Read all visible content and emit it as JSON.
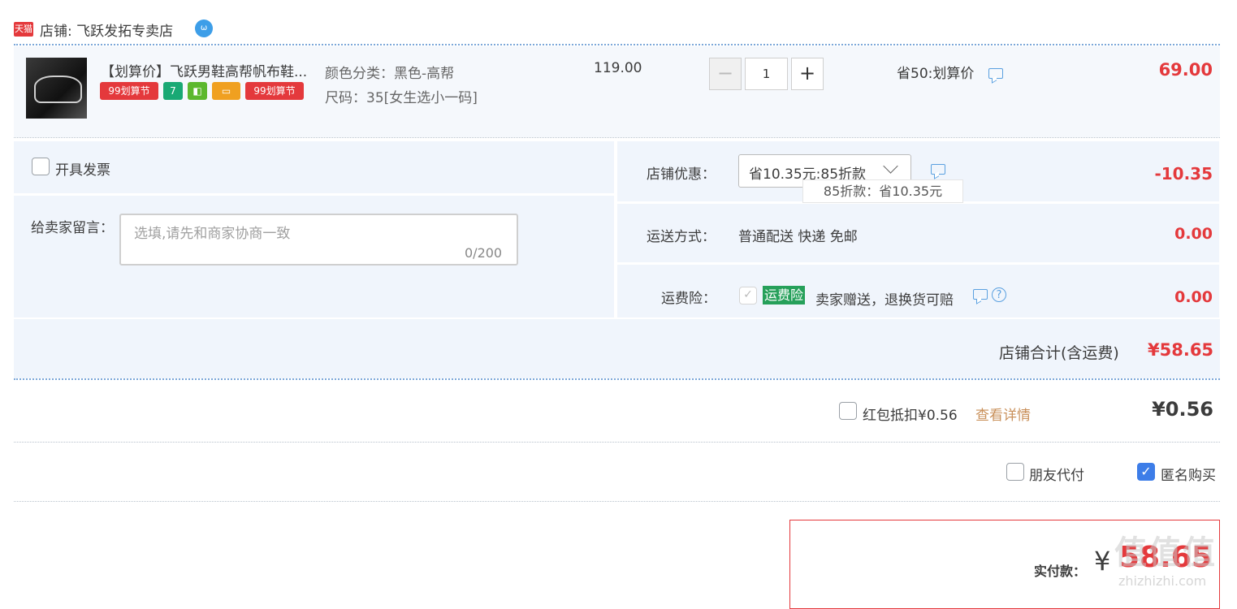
{
  "shop": {
    "logo_text": "天猫",
    "name": "店铺: 飞跃发拓专卖店",
    "im_icon": "wangwang-icon"
  },
  "product": {
    "title": "【划算价】飞跃男鞋高帮帆布鞋...",
    "badges": [
      {
        "text": "99划算节",
        "color": "#e4393c"
      },
      {
        "text": "7",
        "color": "#19a974"
      },
      {
        "text": "◧",
        "color": "#5cb82e"
      },
      {
        "text": "▭",
        "color": "#f0a020"
      },
      {
        "text": "99划算节",
        "color": "#e4393c"
      }
    ],
    "color_attr": "颜色分类：黑色-高帮",
    "size_attr": "尺码：35[女生选小一码]",
    "unit_price": "119.00",
    "quantity": "1",
    "minus_label": "−",
    "plus_label": "+",
    "promo": "省50:划算价",
    "total": "69.00"
  },
  "invoice": {
    "label": "开具发票",
    "checked": false
  },
  "message": {
    "label": "给卖家留言：",
    "placeholder": "选填,请先和商家协商一致",
    "counter": "0/200"
  },
  "shop_discount": {
    "label": "店铺优惠：",
    "selected": "省10.35元:85折款",
    "tooltip": "85折款：省10.35元",
    "amount": "-10.35"
  },
  "shipping": {
    "label": "运送方式：",
    "value": "普通配送 快递 免邮",
    "amount": "0.00"
  },
  "insurance": {
    "label": "运费险：",
    "tag": "运费险",
    "desc": "卖家赠送，退换货可赔",
    "help": "?",
    "amount": "0.00"
  },
  "shop_total": {
    "label": "店铺合计(含运费)",
    "value": "¥58.65"
  },
  "red_packet": {
    "label": "红包抵扣¥0.56",
    "link": "查看详情",
    "value": "¥0.56"
  },
  "options": {
    "friend_pay": {
      "label": "朋友代付",
      "checked": false
    },
    "anonymous": {
      "label": "匿名购买",
      "checked": true
    }
  },
  "payment": {
    "label": "实付款：",
    "currency": "¥",
    "value": "58.65"
  },
  "watermark": {
    "text": "值值值",
    "domain": "zhizhizhi.com"
  }
}
